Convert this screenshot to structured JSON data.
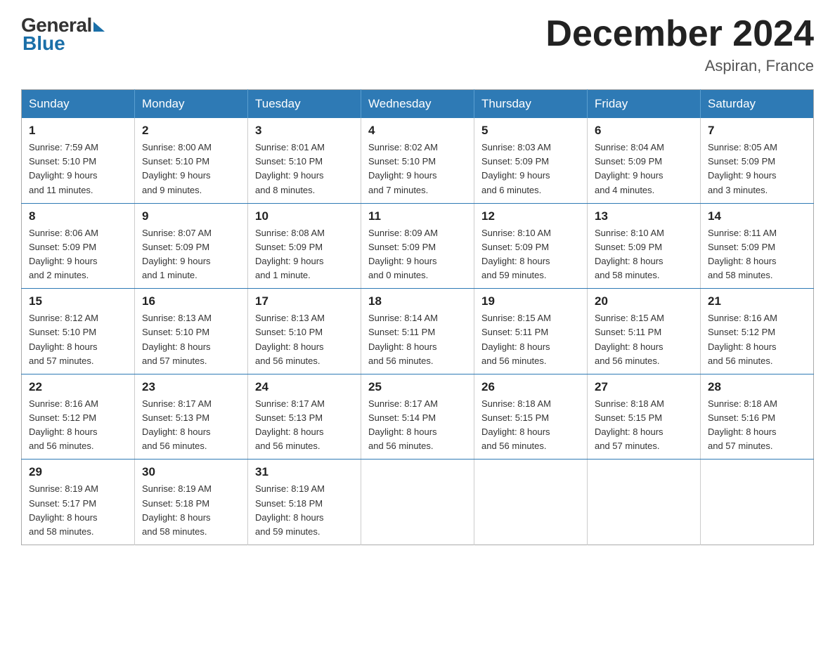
{
  "logo": {
    "general": "General",
    "blue": "Blue"
  },
  "title": "December 2024",
  "location": "Aspiran, France",
  "days_of_week": [
    "Sunday",
    "Monday",
    "Tuesday",
    "Wednesday",
    "Thursday",
    "Friday",
    "Saturday"
  ],
  "weeks": [
    [
      {
        "day": "1",
        "sunrise": "7:59 AM",
        "sunset": "5:10 PM",
        "daylight": "9 hours",
        "daylight2": "and 11 minutes."
      },
      {
        "day": "2",
        "sunrise": "8:00 AM",
        "sunset": "5:10 PM",
        "daylight": "9 hours",
        "daylight2": "and 9 minutes."
      },
      {
        "day": "3",
        "sunrise": "8:01 AM",
        "sunset": "5:10 PM",
        "daylight": "9 hours",
        "daylight2": "and 8 minutes."
      },
      {
        "day": "4",
        "sunrise": "8:02 AM",
        "sunset": "5:10 PM",
        "daylight": "9 hours",
        "daylight2": "and 7 minutes."
      },
      {
        "day": "5",
        "sunrise": "8:03 AM",
        "sunset": "5:09 PM",
        "daylight": "9 hours",
        "daylight2": "and 6 minutes."
      },
      {
        "day": "6",
        "sunrise": "8:04 AM",
        "sunset": "5:09 PM",
        "daylight": "9 hours",
        "daylight2": "and 4 minutes."
      },
      {
        "day": "7",
        "sunrise": "8:05 AM",
        "sunset": "5:09 PM",
        "daylight": "9 hours",
        "daylight2": "and 3 minutes."
      }
    ],
    [
      {
        "day": "8",
        "sunrise": "8:06 AM",
        "sunset": "5:09 PM",
        "daylight": "9 hours",
        "daylight2": "and 2 minutes."
      },
      {
        "day": "9",
        "sunrise": "8:07 AM",
        "sunset": "5:09 PM",
        "daylight": "9 hours",
        "daylight2": "and 1 minute."
      },
      {
        "day": "10",
        "sunrise": "8:08 AM",
        "sunset": "5:09 PM",
        "daylight": "9 hours",
        "daylight2": "and 1 minute."
      },
      {
        "day": "11",
        "sunrise": "8:09 AM",
        "sunset": "5:09 PM",
        "daylight": "9 hours",
        "daylight2": "and 0 minutes."
      },
      {
        "day": "12",
        "sunrise": "8:10 AM",
        "sunset": "5:09 PM",
        "daylight": "8 hours",
        "daylight2": "and 59 minutes."
      },
      {
        "day": "13",
        "sunrise": "8:10 AM",
        "sunset": "5:09 PM",
        "daylight": "8 hours",
        "daylight2": "and 58 minutes."
      },
      {
        "day": "14",
        "sunrise": "8:11 AM",
        "sunset": "5:09 PM",
        "daylight": "8 hours",
        "daylight2": "and 58 minutes."
      }
    ],
    [
      {
        "day": "15",
        "sunrise": "8:12 AM",
        "sunset": "5:10 PM",
        "daylight": "8 hours",
        "daylight2": "and 57 minutes."
      },
      {
        "day": "16",
        "sunrise": "8:13 AM",
        "sunset": "5:10 PM",
        "daylight": "8 hours",
        "daylight2": "and 57 minutes."
      },
      {
        "day": "17",
        "sunrise": "8:13 AM",
        "sunset": "5:10 PM",
        "daylight": "8 hours",
        "daylight2": "and 56 minutes."
      },
      {
        "day": "18",
        "sunrise": "8:14 AM",
        "sunset": "5:11 PM",
        "daylight": "8 hours",
        "daylight2": "and 56 minutes."
      },
      {
        "day": "19",
        "sunrise": "8:15 AM",
        "sunset": "5:11 PM",
        "daylight": "8 hours",
        "daylight2": "and 56 minutes."
      },
      {
        "day": "20",
        "sunrise": "8:15 AM",
        "sunset": "5:11 PM",
        "daylight": "8 hours",
        "daylight2": "and 56 minutes."
      },
      {
        "day": "21",
        "sunrise": "8:16 AM",
        "sunset": "5:12 PM",
        "daylight": "8 hours",
        "daylight2": "and 56 minutes."
      }
    ],
    [
      {
        "day": "22",
        "sunrise": "8:16 AM",
        "sunset": "5:12 PM",
        "daylight": "8 hours",
        "daylight2": "and 56 minutes."
      },
      {
        "day": "23",
        "sunrise": "8:17 AM",
        "sunset": "5:13 PM",
        "daylight": "8 hours",
        "daylight2": "and 56 minutes."
      },
      {
        "day": "24",
        "sunrise": "8:17 AM",
        "sunset": "5:13 PM",
        "daylight": "8 hours",
        "daylight2": "and 56 minutes."
      },
      {
        "day": "25",
        "sunrise": "8:17 AM",
        "sunset": "5:14 PM",
        "daylight": "8 hours",
        "daylight2": "and 56 minutes."
      },
      {
        "day": "26",
        "sunrise": "8:18 AM",
        "sunset": "5:15 PM",
        "daylight": "8 hours",
        "daylight2": "and 56 minutes."
      },
      {
        "day": "27",
        "sunrise": "8:18 AM",
        "sunset": "5:15 PM",
        "daylight": "8 hours",
        "daylight2": "and 57 minutes."
      },
      {
        "day": "28",
        "sunrise": "8:18 AM",
        "sunset": "5:16 PM",
        "daylight": "8 hours",
        "daylight2": "and 57 minutes."
      }
    ],
    [
      {
        "day": "29",
        "sunrise": "8:19 AM",
        "sunset": "5:17 PM",
        "daylight": "8 hours",
        "daylight2": "and 58 minutes."
      },
      {
        "day": "30",
        "sunrise": "8:19 AM",
        "sunset": "5:18 PM",
        "daylight": "8 hours",
        "daylight2": "and 58 minutes."
      },
      {
        "day": "31",
        "sunrise": "8:19 AM",
        "sunset": "5:18 PM",
        "daylight": "8 hours",
        "daylight2": "and 59 minutes."
      },
      null,
      null,
      null,
      null
    ]
  ],
  "labels": {
    "sunrise": "Sunrise:",
    "sunset": "Sunset:",
    "daylight": "Daylight:"
  }
}
